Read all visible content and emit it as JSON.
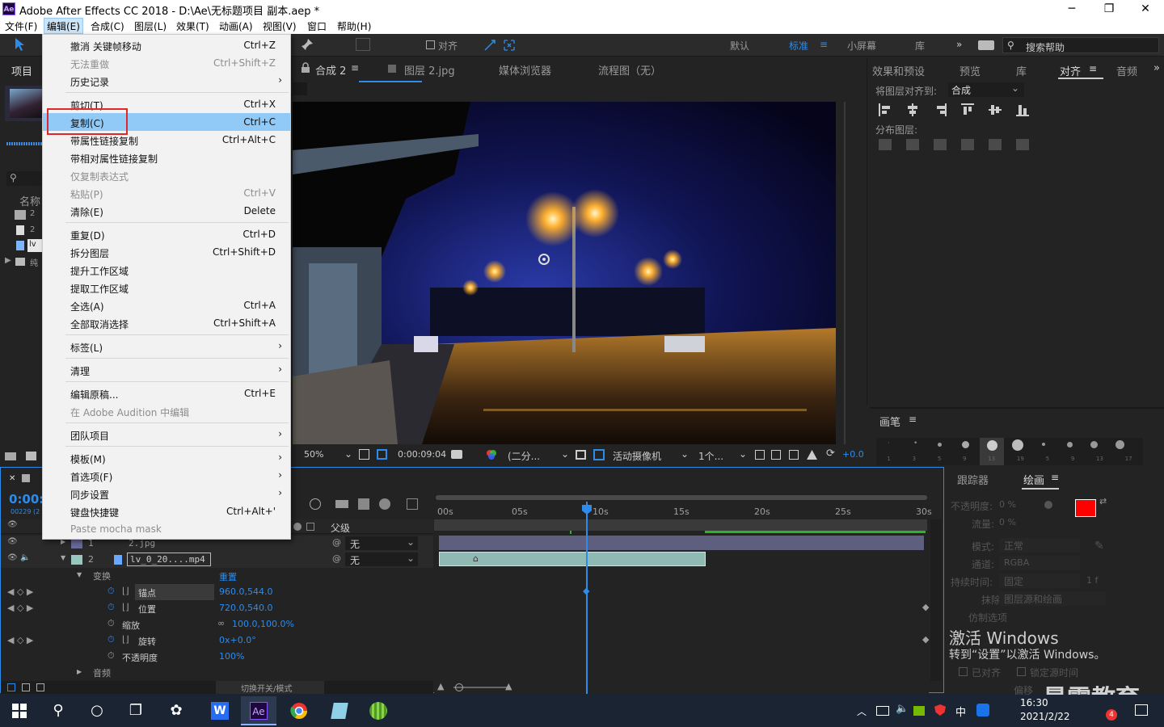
{
  "window": {
    "title": "Adobe After Effects CC 2018 - D:\\Ae\\无标题项目 副本.aep *",
    "minimize": "─",
    "maximize": "❐",
    "close": "✕",
    "app_icon": "Ae"
  },
  "menubar": [
    "文件(F)",
    "编辑(E)",
    "合成(C)",
    "图层(L)",
    "效果(T)",
    "动画(A)",
    "视图(V)",
    "窗口",
    "帮助(H)"
  ],
  "toolbar": {
    "snap_label": "对齐",
    "workspaces": [
      "默认",
      "标准",
      "小屏幕",
      "库"
    ],
    "active_workspace": "标准",
    "more": "»",
    "search_placeholder": "搜索帮助"
  },
  "edit_menu": {
    "items": [
      {
        "label": "撤消 关键帧移动",
        "shortcut": "Ctrl+Z",
        "enabled": true
      },
      {
        "label": "无法重做",
        "shortcut": "Ctrl+Shift+Z",
        "enabled": false
      },
      {
        "label": "历史记录",
        "shortcut": "",
        "submenu": true,
        "enabled": true
      },
      {
        "sep": true
      },
      {
        "label": "剪切(T)",
        "shortcut": "Ctrl+X",
        "enabled": true
      },
      {
        "label": "复制(C)",
        "shortcut": "Ctrl+C",
        "enabled": true,
        "highlighted": true
      },
      {
        "label": "带属性链接复制",
        "shortcut": "Ctrl+Alt+C",
        "enabled": true
      },
      {
        "label": "带相对属性链接复制",
        "shortcut": "",
        "enabled": true
      },
      {
        "label": "仅复制表达式",
        "shortcut": "",
        "enabled": false
      },
      {
        "label": "粘贴(P)",
        "shortcut": "Ctrl+V",
        "enabled": false
      },
      {
        "label": "清除(E)",
        "shortcut": "Delete",
        "enabled": true
      },
      {
        "sep": true
      },
      {
        "label": "重复(D)",
        "shortcut": "Ctrl+D",
        "enabled": true
      },
      {
        "label": "拆分图层",
        "shortcut": "Ctrl+Shift+D",
        "enabled": true
      },
      {
        "label": "提升工作区域",
        "shortcut": "",
        "enabled": true
      },
      {
        "label": "提取工作区域",
        "shortcut": "",
        "enabled": true
      },
      {
        "label": "全选(A)",
        "shortcut": "Ctrl+A",
        "enabled": true
      },
      {
        "label": "全部取消选择",
        "shortcut": "Ctrl+Shift+A",
        "enabled": true
      },
      {
        "sep": true
      },
      {
        "label": "标签(L)",
        "shortcut": "",
        "submenu": true,
        "enabled": true
      },
      {
        "sep": true
      },
      {
        "label": "清理",
        "shortcut": "",
        "submenu": true,
        "enabled": true
      },
      {
        "sep": true
      },
      {
        "label": "编辑原稿...",
        "shortcut": "Ctrl+E",
        "enabled": true
      },
      {
        "label": "在 Adobe Audition 中编辑",
        "shortcut": "",
        "enabled": false
      },
      {
        "sep": true
      },
      {
        "label": "团队项目",
        "shortcut": "",
        "submenu": true,
        "enabled": true
      },
      {
        "sep": true
      },
      {
        "label": "模板(M)",
        "shortcut": "",
        "submenu": true,
        "enabled": true
      },
      {
        "label": "首选项(F)",
        "shortcut": "",
        "submenu": true,
        "enabled": true
      },
      {
        "label": "同步设置",
        "shortcut": "",
        "submenu": true,
        "enabled": true
      },
      {
        "label": "键盘快捷键",
        "shortcut": "Ctrl+Alt+'",
        "enabled": true
      },
      {
        "label": "Paste mocha mask",
        "shortcut": "",
        "enabled": false
      }
    ]
  },
  "project_panel": {
    "tab": "项目",
    "search_icon": "⚲",
    "name_header": "名称",
    "items": [
      "2",
      "2",
      "lv",
      "纯"
    ]
  },
  "viewer": {
    "tabs": [
      "合成 2",
      "图层 2.jpg",
      "媒体浏览器",
      "流程图（无）"
    ],
    "zoom": "50%",
    "timecode": "0:00:09:04",
    "resolution": "(二分...",
    "camera": "活动摄像机",
    "views": "1个...",
    "exposure": "+0.0"
  },
  "right_panel": {
    "tabs": [
      "效果和预设",
      "预览",
      "库",
      "对齐",
      "音频"
    ],
    "align_to_label": "将图层对齐到:",
    "align_to_value": "合成",
    "distribute_label": "分布图层:",
    "brush_tab": "画笔",
    "brush_sizes": [
      "1",
      "3",
      "5",
      "9",
      "13",
      "19",
      "5",
      "9",
      "13",
      "17"
    ]
  },
  "paint_panel": {
    "tabs": [
      "跟踪器",
      "绘画"
    ],
    "opacity_label": "不透明度:",
    "opacity": "0 %",
    "flow_label": "流量:",
    "flow": "0 %",
    "mode_label": "模式:",
    "mode": "正常",
    "channel_label": "通道:",
    "channel": "RGBA",
    "duration_label": "持续时间:",
    "duration": "固定",
    "duration_val": "1 f",
    "erase_label": "抹除:",
    "erase": "图层源和绘画",
    "clone_label": "仿制选项",
    "aligned": "已对齐",
    "lock_time": "锁定源时间",
    "offset": "偏移",
    "fg_color": "#ff0000",
    "bg_color": "#ffffff"
  },
  "timeline": {
    "timecode": "0:00:",
    "frames": "00229 (2",
    "parent_header": "父级",
    "ruler": [
      "00s",
      "05s",
      "10s",
      "15s",
      "20s",
      "25s",
      "30s"
    ],
    "layers": [
      {
        "num": "1",
        "name": "2.jpg",
        "parent": "无"
      },
      {
        "num": "2",
        "name": "lv_0_20....mp4",
        "parent": "无"
      }
    ],
    "transform_label": "变换",
    "reset_label": "重置",
    "props": [
      {
        "name": "锚点",
        "value": "960.0,544.0"
      },
      {
        "name": "位置",
        "value": "720.0,540.0"
      },
      {
        "name": "缩放",
        "value": "100.0,100.0%"
      },
      {
        "name": "旋转",
        "value": "0x+0.0°"
      },
      {
        "name": "不透明度",
        "value": "100%"
      }
    ],
    "audio_label": "音频",
    "switch_mode": "切换开关/模式"
  },
  "watermark": {
    "line1": "激活 Windows",
    "line2": "转到“设置”以激活 Windows。",
    "brand": "最需教育"
  },
  "taskbar": {
    "time": "16:30",
    "date": "2021/2/22",
    "ime": "中",
    "badge": "4"
  }
}
